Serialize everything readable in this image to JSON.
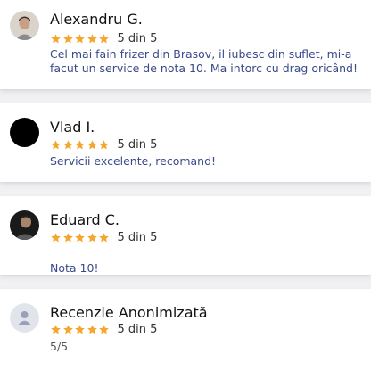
{
  "reviews": [
    {
      "name": "Alexandru G.",
      "avatar": "profile-photo",
      "stars": 5,
      "score_text": "5 din 5",
      "text": "Cel mai fain frizer din Brasov, il iubesc din suflet, mi-a\nfacut un service de nota 10. Ma intorc cu drag oricând!"
    },
    {
      "name": "Vlad I.",
      "avatar": "profile-photo",
      "stars": 5,
      "score_text": "5 din 5",
      "text": "Servicii excelente, recomand!"
    },
    {
      "name": "Eduard C.",
      "avatar": "profile-photo",
      "stars": 5,
      "score_text": "5 din 5",
      "text": "Nota 10!",
      "emoji": "👏 👏"
    },
    {
      "name": "Recenzie Anonimizată",
      "avatar": "anonymous-user-icon",
      "stars": 5,
      "score_text": "5 din 5",
      "text": "5/5"
    }
  ],
  "colors": {
    "star": "#f4a72c",
    "review_text": "#3a4a8a",
    "background": "#f1f1f3",
    "card": "#ffffff"
  }
}
